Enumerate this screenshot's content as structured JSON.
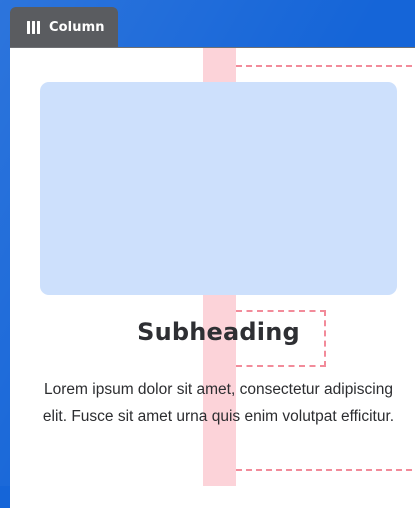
{
  "tab": {
    "label": "Column",
    "icon": "columns-icon"
  },
  "content": {
    "subheading": "Subheading",
    "body": "Lorem ipsum dolor sit amet, consectetur adipiscing elit. Fusce sit amet urna quis enim volutpat efficitur."
  },
  "colors": {
    "background": "#1565d8",
    "tab": "#5a5c60",
    "image_placeholder": "#cde0fc",
    "guide_strip": "#fcd3d9",
    "guide_dashes": "#f28b9a"
  }
}
